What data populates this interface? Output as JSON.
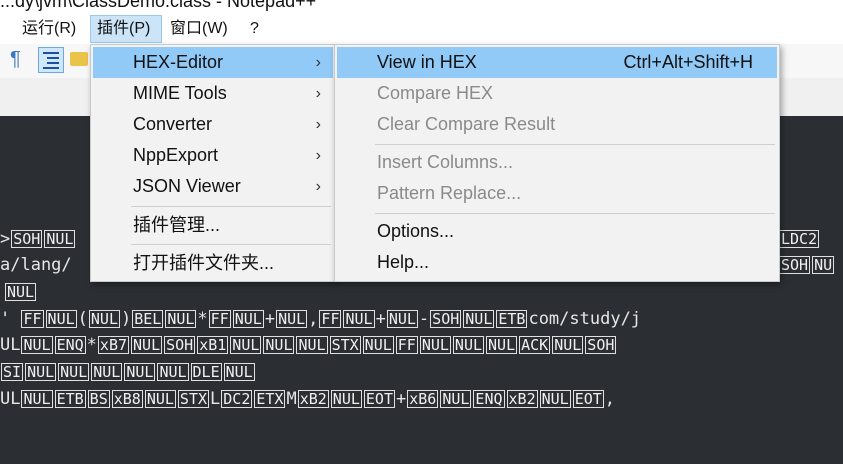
{
  "window": {
    "title_fragment": "...dy\\jvm\\ClassDemo.class - Notepad++"
  },
  "menubar": {
    "items": [
      "运行(R)",
      "插件(P)",
      "窗口(W)",
      "?"
    ]
  },
  "plugins_menu": {
    "items": [
      "HEX-Editor",
      "MIME Tools",
      "Converter",
      "NppExport",
      "JSON Viewer"
    ],
    "manage": "插件管理...",
    "open_folder": "打开插件文件夹..."
  },
  "hex_submenu": {
    "view_hex": "View in HEX",
    "view_hex_shortcut": "Ctrl+Alt+Shift+H",
    "compare_hex": "Compare HEX",
    "clear_compare": "Clear Compare Result",
    "insert_columns": "Insert Columns...",
    "pattern_replace": "Pattern Replace...",
    "options": "Options...",
    "help": "Help..."
  },
  "editor": {
    "l1_left_tok1": "SOH",
    "l1_left_tok2": "NUL",
    "l1_right_tok": "LDC2",
    "l2_text": "a/lang/",
    "l2_right_tok": "SOH",
    "l2_right_tok2": "NU",
    "l3_tok": "NUL",
    "l4": [
      "FF",
      "NUL",
      "(",
      "NUL",
      ")",
      "BEL",
      "NUL",
      "*",
      "FF",
      "NUL",
      "+",
      "NUL",
      ",",
      "FF",
      "NUL",
      "+",
      "NUL",
      "-",
      "SOH",
      "NUL",
      "ETB",
      "com/study/j"
    ],
    "l5": [
      "UL",
      "NUL",
      "ENQ",
      "*",
      "xB7",
      "NUL",
      "SOH",
      "xB1",
      "NUL",
      "NUL",
      "NUL",
      "STX",
      "NUL",
      "FF",
      "NUL",
      "NUL",
      "NUL",
      "ACK",
      "NUL",
      "SOH"
    ],
    "l6": [
      "SI",
      "NUL",
      "NUL",
      "NUL",
      "NUL",
      "NUL",
      "DLE",
      "NUL"
    ],
    "l7": [
      "UL",
      "NUL",
      "ETB",
      "BS",
      "xB8",
      "NUL",
      "STX",
      "L",
      "DC2",
      "ETX",
      "M",
      "xB2",
      "NUL",
      "EOT",
      "+",
      "xB6",
      "NUL",
      "ENQ",
      "xB2",
      "NUL",
      "EOT",
      ","
    ]
  }
}
